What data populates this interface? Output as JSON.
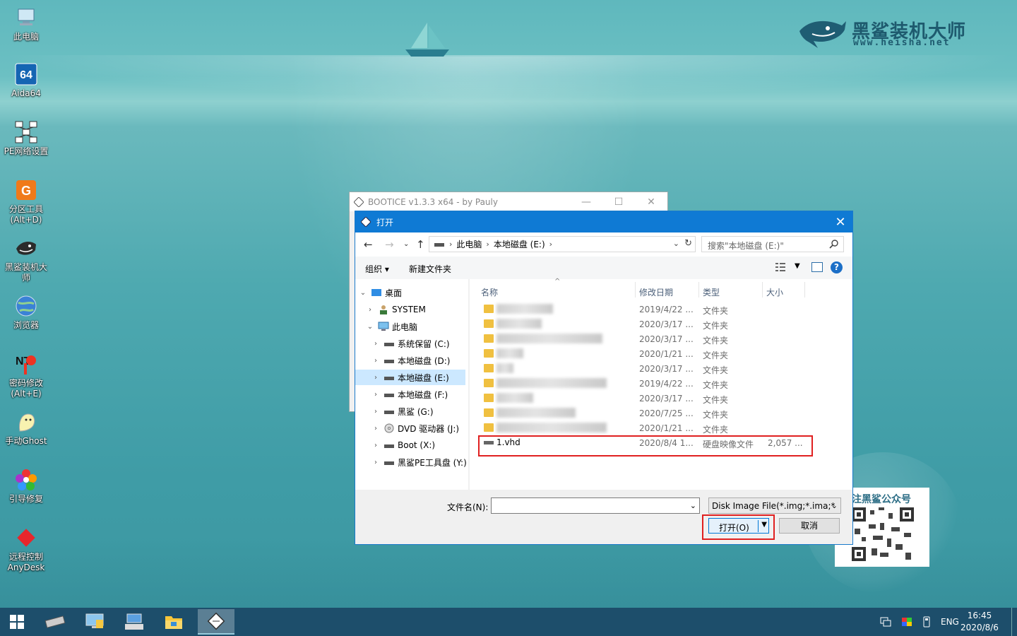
{
  "desktop": {
    "icons": [
      {
        "label": "此电脑",
        "icon": "computer-icon"
      },
      {
        "label": "Aida64",
        "icon": "aida64-icon"
      },
      {
        "label": "PE网络设置",
        "icon": "network-icon"
      },
      {
        "label": "分区工具\n(Alt+D)",
        "icon": "partition-icon"
      },
      {
        "label": "黑鲨装机大\n师",
        "icon": "shark-icon"
      },
      {
        "label": "浏览器",
        "icon": "browser-icon"
      },
      {
        "label": "密码修改\n(Alt+E)",
        "icon": "password-icon"
      },
      {
        "label": "手动Ghost",
        "icon": "ghost-icon"
      },
      {
        "label": "引导修复",
        "icon": "boot-repair-icon"
      },
      {
        "label": "远程控制\nAnyDesk",
        "icon": "anydesk-icon"
      }
    ]
  },
  "brand": {
    "name": "黑鲨装机大师",
    "url": "www.heisha.net"
  },
  "qr": {
    "title": "注黑鲨公众号"
  },
  "bootice": {
    "title": "BOOTICE v1.3.3 x64 - by Pauly"
  },
  "dialog": {
    "title": "打开",
    "address": {
      "segments": [
        "此电脑",
        "本地磁盘 (E:)"
      ]
    },
    "search_placeholder": "搜索\"本地磁盘 (E:)\"",
    "toolbar": {
      "organize": "组织 ▾",
      "new_folder": "新建文件夹",
      "help": "?"
    },
    "tree": [
      {
        "label": "桌面",
        "expanded": true,
        "level": 0,
        "icon": "desktop-folder-icon"
      },
      {
        "label": "SYSTEM",
        "expanded": false,
        "level": 1,
        "icon": "user-icon"
      },
      {
        "label": "此电脑",
        "expanded": true,
        "level": 1,
        "icon": "computer-icon"
      },
      {
        "label": "系统保留 (C:)",
        "expanded": false,
        "level": 2,
        "icon": "drive-icon"
      },
      {
        "label": "本地磁盘 (D:)",
        "expanded": false,
        "level": 2,
        "icon": "drive-icon"
      },
      {
        "label": "本地磁盘 (E:)",
        "expanded": false,
        "level": 2,
        "icon": "drive-icon",
        "selected": true
      },
      {
        "label": "本地磁盘 (F:)",
        "expanded": false,
        "level": 2,
        "icon": "drive-icon"
      },
      {
        "label": "黑鲨 (G:)",
        "expanded": false,
        "level": 2,
        "icon": "drive-icon"
      },
      {
        "label": "DVD 驱动器 (J:)",
        "expanded": false,
        "level": 2,
        "icon": "dvd-icon"
      },
      {
        "label": "Boot (X:)",
        "expanded": false,
        "level": 2,
        "icon": "drive-icon"
      },
      {
        "label": "黑鲨PE工具盘 (Y:)",
        "expanded": false,
        "level": 2,
        "icon": "drive-icon"
      }
    ],
    "columns": {
      "name": "名称",
      "date": "修改日期",
      "type": "类型",
      "size": "大小"
    },
    "rows": [
      {
        "date": "2019/4/22 ...",
        "type": "文件夹",
        "size": ""
      },
      {
        "date": "2020/3/17 ...",
        "type": "文件夹",
        "size": ""
      },
      {
        "date": "2020/3/17 ...",
        "type": "文件夹",
        "size": ""
      },
      {
        "date": "2020/1/21 ...",
        "type": "文件夹",
        "size": ""
      },
      {
        "date": "2020/3/17 ...",
        "type": "文件夹",
        "size": ""
      },
      {
        "date": "2019/4/22 ...",
        "type": "文件夹",
        "size": ""
      },
      {
        "date": "2020/3/17 ...",
        "type": "文件夹",
        "size": ""
      },
      {
        "date": "2020/7/25 ...",
        "type": "文件夹",
        "size": ""
      },
      {
        "date": "2020/1/21 ...",
        "type": "文件夹",
        "size": ""
      }
    ],
    "file_row": {
      "name": "1.vhd",
      "date": "2020/8/4 1...",
      "type": "硬盘映像文件",
      "size": "2,057 ..."
    },
    "filename_label": "文件名(N):",
    "filename_value": "",
    "filetype": "Disk Image File(*.img;*.ima;*",
    "open_button": "打开(O)",
    "cancel_button": "取消"
  },
  "taskbar": {
    "language": "ENG",
    "time": "16:45",
    "date": "2020/8/6"
  },
  "colors": {
    "accent": "#0f7ad4",
    "highlight": "#e02020",
    "selected": "#cce8ff"
  }
}
